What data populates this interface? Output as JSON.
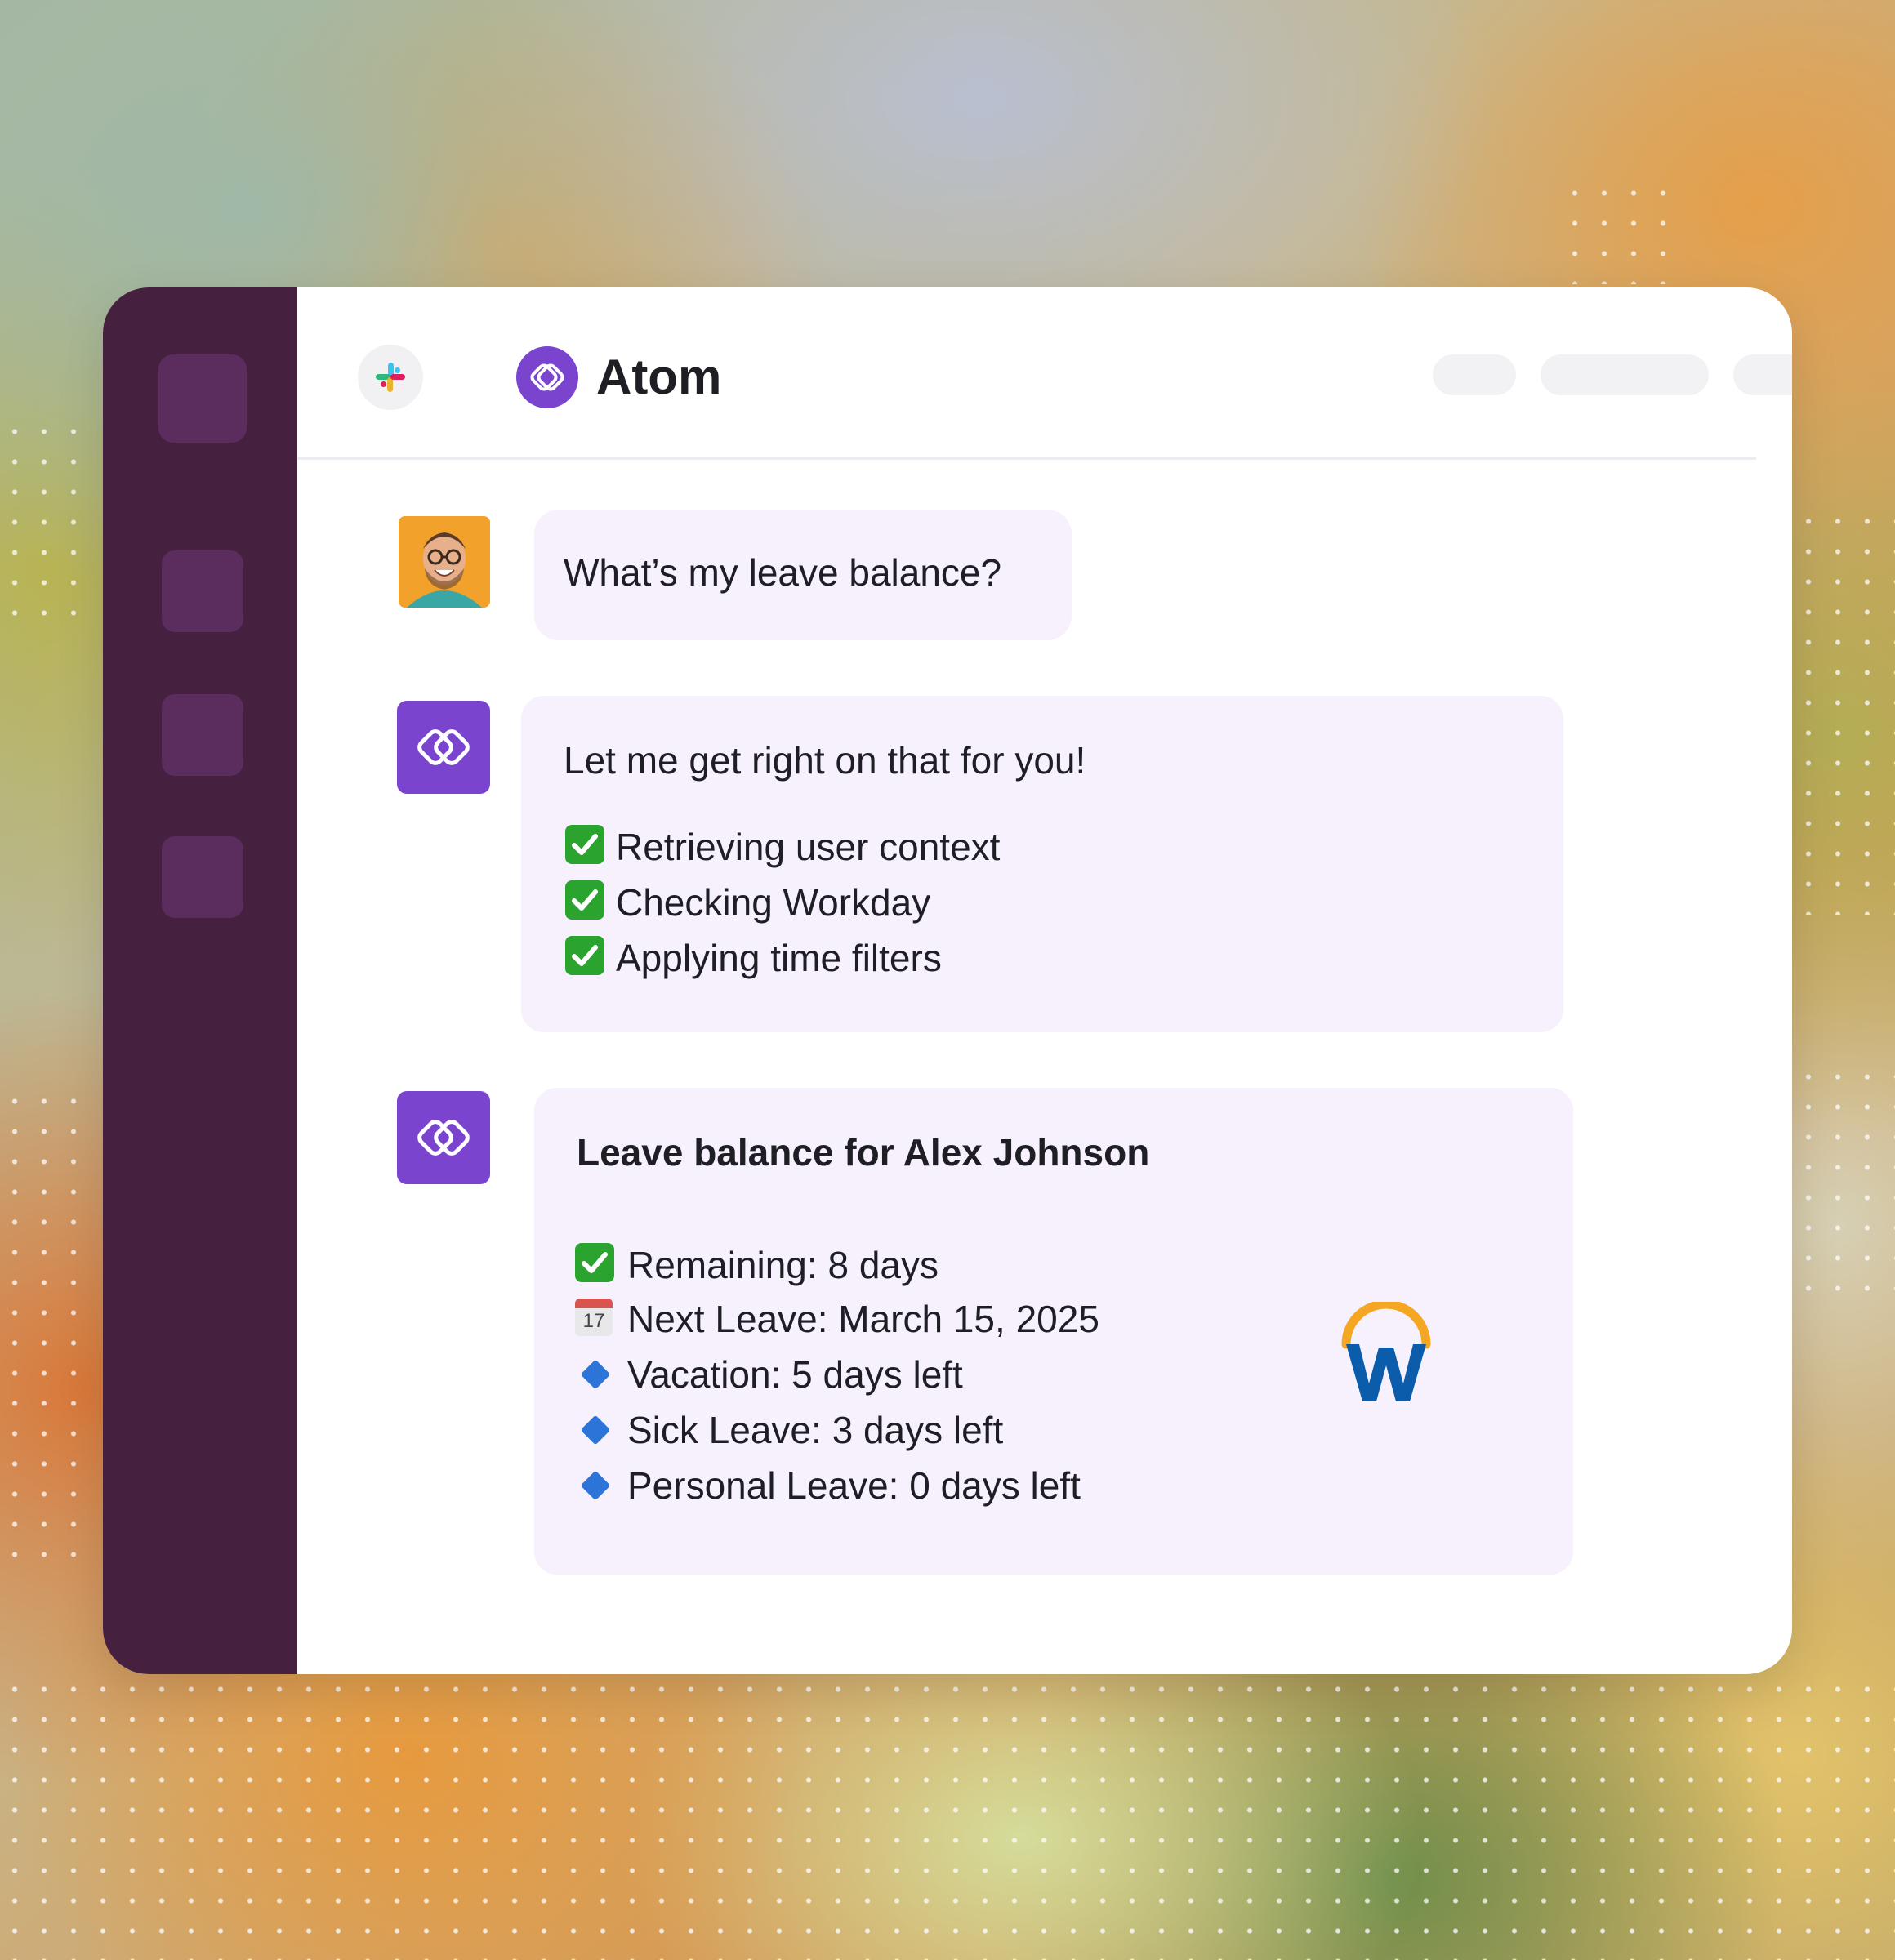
{
  "app": {
    "title": "Atom"
  },
  "chat": {
    "user_message": "What’s my leave balance?",
    "bot_reply": {
      "intro": "Let me get right on that for you!",
      "steps": [
        "Retrieving user context",
        "Checking Workday",
        "Applying time filters"
      ]
    },
    "balance_card": {
      "title": "Leave balance for Alex Johnson",
      "remaining": "Remaining: 8 days",
      "next_leave": "Next Leave: March 15, 2025",
      "calendar_day": "17",
      "items": [
        "Vacation: 5 days left",
        "Sick Leave: 3 days left",
        "Personal Leave: 0 days left"
      ]
    }
  },
  "icons": {
    "check": "check-mark-icon",
    "calendar": "calendar-icon",
    "diamond": "blue-diamond-icon",
    "workday": "workday-logo"
  },
  "colors": {
    "sidebar": "#45203f",
    "sidebar_button": "#5b2d5f",
    "brand_purple": "#7a44cf",
    "bubble": "#f6f1fd",
    "check_green": "#2ba32f",
    "diamond_blue": "#2d74d8",
    "workday_blue": "#0b5cab",
    "workday_orange": "#f5a623"
  }
}
